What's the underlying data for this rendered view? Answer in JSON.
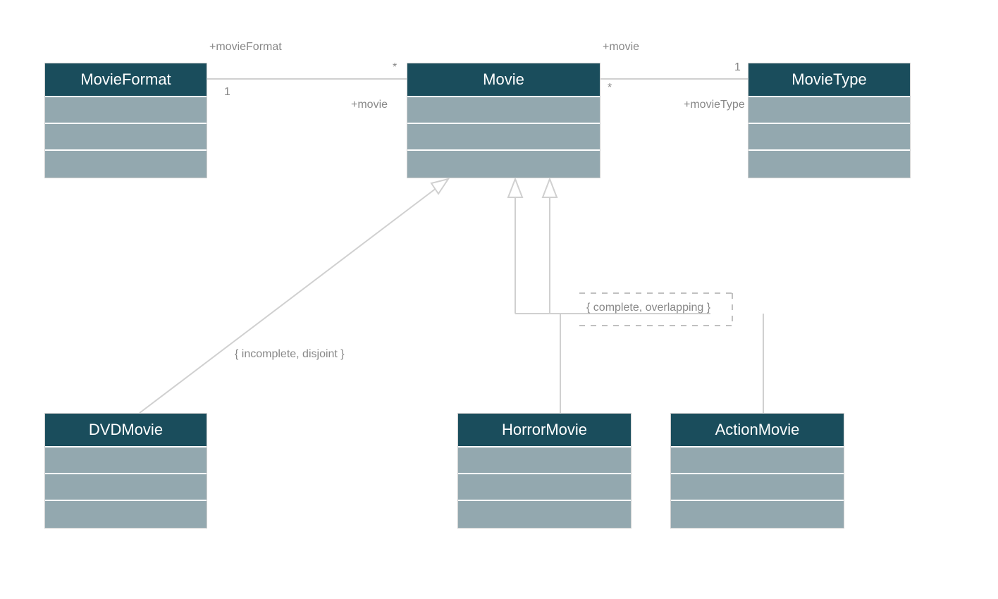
{
  "classes": {
    "movieFormat": {
      "name": "MovieFormat"
    },
    "movie": {
      "name": "Movie"
    },
    "movieType": {
      "name": "MovieType"
    },
    "dvdMovie": {
      "name": "DVDMovie"
    },
    "horrorMovie": {
      "name": "HorrorMovie"
    },
    "actionMovie": {
      "name": "ActionMovie"
    }
  },
  "associations": {
    "movieFormat_movie": {
      "roleLeft": "+movieFormat",
      "multLeft": "1",
      "roleRight": "+movie",
      "multRight": "*"
    },
    "movie_movieType": {
      "roleLeft": "+movie",
      "multLeft": "*",
      "roleRight": "+movieType",
      "multRight": "1"
    }
  },
  "constraints": {
    "formatGen": "{ incomplete, disjoint }",
    "typeGen": "{ complete, overlapping }"
  }
}
